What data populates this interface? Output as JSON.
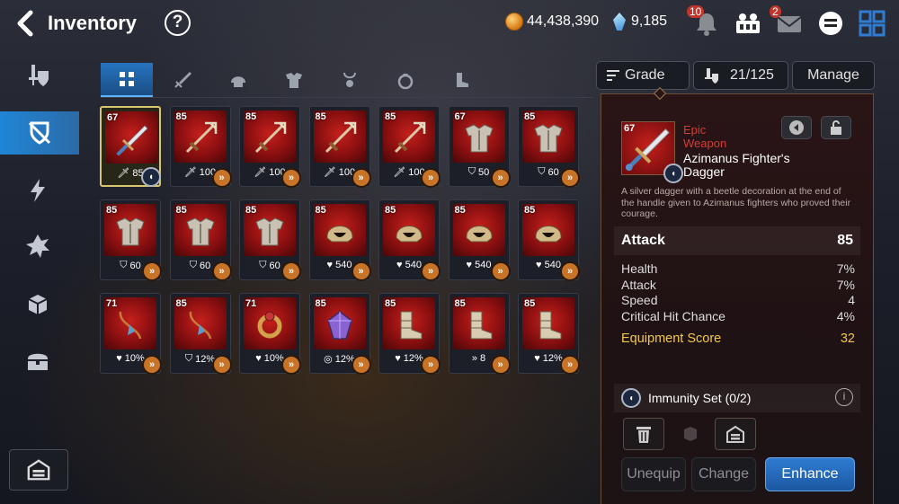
{
  "header": {
    "title": "Inventory",
    "help_icon": "?",
    "gold": "44,438,390",
    "crystals": "9,185",
    "notifications_count": "10",
    "mail_count": "2"
  },
  "leftnav": {
    "items": [
      "equipment-icon",
      "inventory-gear-icon",
      "skill-icon",
      "artifact-icon",
      "materials-icon",
      "chest-icon"
    ],
    "active": 1,
    "bottom": "storage-icon"
  },
  "tabs": {
    "items": [
      "all-icon",
      "weapon-icon",
      "helmet-icon",
      "armor-icon",
      "necklace-icon",
      "ring-icon",
      "boots-icon"
    ],
    "active": 0
  },
  "toolbar": {
    "sort_label": "Grade",
    "capacity": "21/125",
    "manage_label": "Manage"
  },
  "grid": {
    "items": [
      {
        "level": "67",
        "kind": "dagger",
        "set": "immunity",
        "stat_icon": "attack",
        "stat": "85",
        "selected": true
      },
      {
        "level": "85",
        "kind": "trident",
        "set": "speed",
        "stat_icon": "attack",
        "stat": "100"
      },
      {
        "level": "85",
        "kind": "trident",
        "set": "speed",
        "stat_icon": "attack",
        "stat": "100"
      },
      {
        "level": "85",
        "kind": "trident",
        "set": "speed",
        "stat_icon": "attack",
        "stat": "100"
      },
      {
        "level": "85",
        "kind": "trident",
        "set": "speed",
        "stat_icon": "attack",
        "stat": "100"
      },
      {
        "level": "67",
        "kind": "armor",
        "set": "speed",
        "stat_icon": "defense",
        "stat": "50"
      },
      {
        "level": "85",
        "kind": "armor",
        "set": "speed",
        "stat_icon": "defense",
        "stat": "60"
      },
      {
        "level": "85",
        "kind": "armor",
        "set": "speed",
        "stat_icon": "defense",
        "stat": "60"
      },
      {
        "level": "85",
        "kind": "armor",
        "set": "speed",
        "stat_icon": "defense",
        "stat": "60"
      },
      {
        "level": "85",
        "kind": "armor",
        "set": "speed",
        "stat_icon": "defense",
        "stat": "60"
      },
      {
        "level": "85",
        "kind": "helmet",
        "set": "speed",
        "stat_icon": "health",
        "stat": "540"
      },
      {
        "level": "85",
        "kind": "helmet",
        "set": "speed",
        "stat_icon": "health",
        "stat": "540"
      },
      {
        "level": "85",
        "kind": "helmet",
        "set": "speed",
        "stat_icon": "health",
        "stat": "540"
      },
      {
        "level": "85",
        "kind": "helmet",
        "set": "speed",
        "stat_icon": "health",
        "stat": "540"
      },
      {
        "level": "71",
        "kind": "necklace",
        "set": "speed",
        "stat_icon": "health",
        "stat": "10%"
      },
      {
        "level": "85",
        "kind": "necklace",
        "set": "speed",
        "stat_icon": "defense",
        "stat": "12%"
      },
      {
        "level": "71",
        "kind": "ring",
        "set": "speed",
        "stat_icon": "health",
        "stat": "10%"
      },
      {
        "level": "85",
        "kind": "gem",
        "set": "speed",
        "stat_icon": "effect",
        "stat": "12%"
      },
      {
        "level": "85",
        "kind": "boots",
        "set": "speed",
        "stat_icon": "health",
        "stat": "12%"
      },
      {
        "level": "85",
        "kind": "boots",
        "set": "speed",
        "stat_icon": "speed",
        "stat": "8"
      },
      {
        "level": "85",
        "kind": "boots",
        "set": "speed",
        "stat_icon": "health",
        "stat": "12%"
      }
    ]
  },
  "detail": {
    "level": "67",
    "rarity": "Epic Weapon",
    "name": "Azimanus Fighter's Dagger",
    "description": "A silver dagger with a beetle decoration at the end of the handle given to Azimanus fighters who proved their courage.",
    "main_stat": {
      "label": "Attack",
      "value": "85"
    },
    "substats": [
      {
        "label": "Health",
        "value": "7%"
      },
      {
        "label": "Attack",
        "value": "7%"
      },
      {
        "label": "Speed",
        "value": "4"
      },
      {
        "label": "Critical Hit Chance",
        "value": "4%"
      }
    ],
    "score_label": "Equipment Score",
    "score_value": "32",
    "set_label": "Immunity Set (0/2)",
    "unequip_label": "Unequip",
    "change_label": "Change",
    "enhance_label": "Enhance"
  },
  "colors": {
    "accent": "#2f7cd2",
    "epic": "#d33c36",
    "score": "#f0c94a",
    "select": "#d8c570"
  }
}
